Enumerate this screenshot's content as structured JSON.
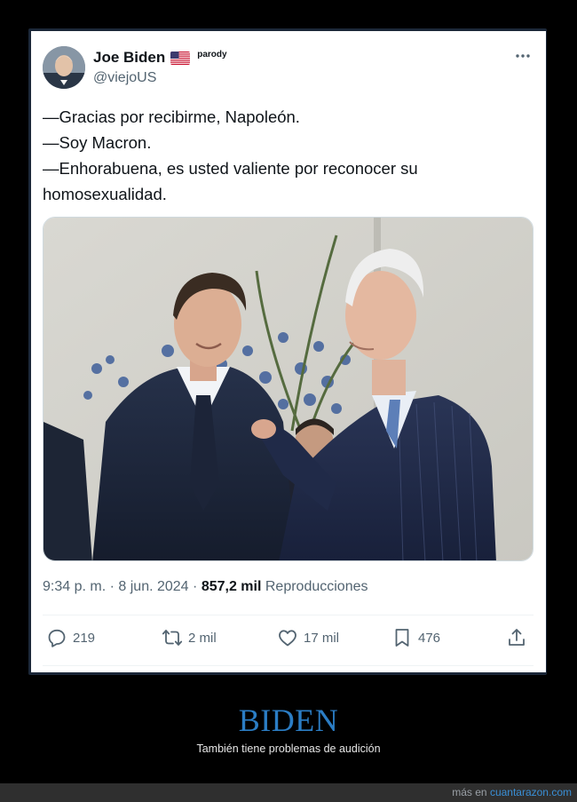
{
  "tweet": {
    "display_name": "Joe Biden",
    "flag_icon": "us-flag-icon",
    "badge": "parody",
    "handle": "@viejoUS",
    "more_icon": "more-dots-icon",
    "lines": [
      "—Gracias por recibirme, Napoleón.",
      "—Soy Macron.",
      "—Enhorabuena, es usted valiente por reconocer su",
      "homosexualidad."
    ],
    "time": "9:34 p. m.",
    "sep1": "·",
    "date": "8 jun. 2024",
    "sep2": "·",
    "views_count": "857,2 mil",
    "views_label": "Reproducciones",
    "actions": {
      "replies": "219",
      "reposts": "2 mil",
      "likes": "17 mil",
      "bookmarks": "476"
    }
  },
  "footer": {
    "title": "BIDEN",
    "subtitle": "También tiene problemas de audición",
    "credit_prefix": "más en",
    "credit_site": "cuantarazon.com"
  },
  "colors": {
    "accent_blue": "#2b7dc4",
    "text_primary": "#0f1419",
    "text_secondary": "#536471"
  }
}
